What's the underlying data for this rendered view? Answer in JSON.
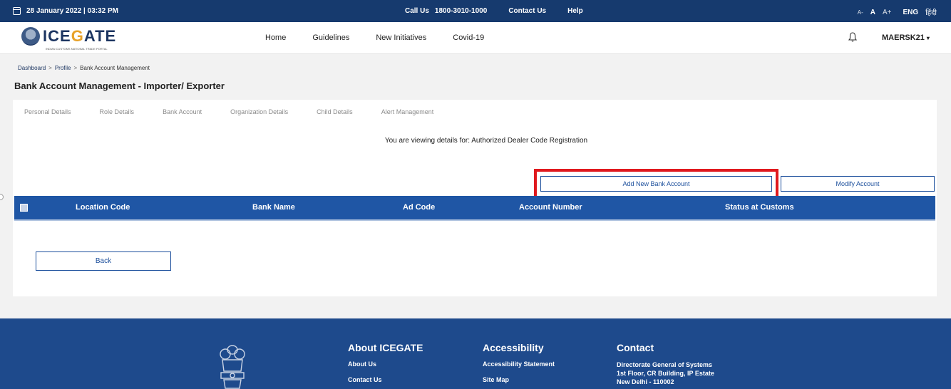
{
  "topbar": {
    "date": "28 January 2022 | 03:32 PM",
    "call_label": "Call Us",
    "call_number": "1800-3010-1000",
    "contact": "Contact Us",
    "help": "Help",
    "font_small": "A-",
    "font_normal": "A",
    "font_large": "A+",
    "lang_eng": "ENG",
    "lang_hindi": "हिंदी"
  },
  "header": {
    "logo_text_1": "ICE",
    "logo_text_accent": "G",
    "logo_text_2": "ATE",
    "logo_sub": "INDIAN CUSTOMS NATIONAL TRADE PORTAL",
    "nav": {
      "home": "Home",
      "guidelines": "Guidelines",
      "new_initiatives": "New Initiatives",
      "covid": "Covid-19"
    },
    "user": "MAERSK21",
    "user_caret": "▾"
  },
  "breadcrumb": {
    "dashboard": "Dashboard",
    "profile": "Profile",
    "current": "Bank Account Management",
    "separator": ">"
  },
  "page_title": "Bank Account Management - Importer/ Exporter",
  "tabs": {
    "personal": "Personal Details",
    "role": "Role Details",
    "bank": "Bank Account",
    "organization": "Organization Details",
    "child": "Child Details",
    "alert": "Alert Management"
  },
  "viewing_text": "You are viewing details for: Authorized Dealer Code Registration",
  "buttons": {
    "add_bank": "Add New Bank Account",
    "modify": "Modify Account",
    "back": "Back"
  },
  "table": {
    "columns": [
      "Location Code",
      "Bank Name",
      "Ad Code",
      "Account Number",
      "Status at Customs"
    ]
  },
  "footer": {
    "about": {
      "heading": "About ICEGATE",
      "links": [
        "About Us",
        "Contact Us"
      ]
    },
    "accessibility": {
      "heading": "Accessibility",
      "links": [
        "Accessibility Statement",
        "Site Map"
      ]
    },
    "contact": {
      "heading": "Contact",
      "lines": [
        "Directorate General of Systems",
        "1st Floor, CR Building, IP Estate",
        "New Delhi - 110002"
      ]
    }
  },
  "colors": {
    "topbar": "#163a6e",
    "table_header": "#1f56a5",
    "footer": "#1e4a8c",
    "highlight": "#e0191e",
    "logo_accent": "#e8a22a"
  }
}
